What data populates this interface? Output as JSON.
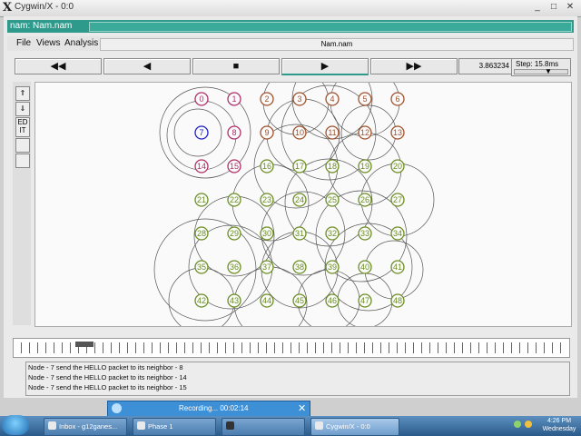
{
  "window": {
    "title": "Cygwin/X - 0:0"
  },
  "nam": {
    "title": "nam: Nam.nam",
    "file_name": "Nam.nam"
  },
  "menu": {
    "file": "File",
    "views": "Views",
    "analysis": "Analysis"
  },
  "controls": {
    "rewind": "◀◀",
    "back": "◀",
    "stop": "■",
    "play": "▶",
    "fast_forward": "▶▶",
    "time": "3.863234",
    "step": "Step: 15.8ms"
  },
  "tools": {
    "zoom_in": "⇑",
    "zoom_out": "⇓",
    "edit": "ED IT",
    "t4": "",
    "t5": ""
  },
  "network": {
    "nodes": [
      {
        "id": "0",
        "color": "#b0306a"
      },
      {
        "id": "1",
        "color": "#b0306a"
      },
      {
        "id": "2",
        "color": "#a0522d"
      },
      {
        "id": "3",
        "color": "#a0522d"
      },
      {
        "id": "4",
        "color": "#a0522d"
      },
      {
        "id": "5",
        "color": "#a0522d"
      },
      {
        "id": "6",
        "color": "#a0522d"
      },
      {
        "id": "7",
        "color": "#2020c8"
      },
      {
        "id": "8",
        "color": "#b0306a"
      },
      {
        "id": "9",
        "color": "#a0522d"
      },
      {
        "id": "10",
        "color": "#a0522d"
      },
      {
        "id": "11",
        "color": "#a0522d"
      },
      {
        "id": "12",
        "color": "#a0522d"
      },
      {
        "id": "13",
        "color": "#a0522d"
      },
      {
        "id": "14",
        "color": "#b0306a"
      },
      {
        "id": "15",
        "color": "#b0306a"
      },
      {
        "id": "16",
        "color": "#6b8e23"
      },
      {
        "id": "17",
        "color": "#6b8e23"
      },
      {
        "id": "18",
        "color": "#6b8e23"
      },
      {
        "id": "19",
        "color": "#6b8e23"
      },
      {
        "id": "20",
        "color": "#6b8e23"
      },
      {
        "id": "21",
        "color": "#6b8e23"
      },
      {
        "id": "22",
        "color": "#6b8e23"
      },
      {
        "id": "23",
        "color": "#6b8e23"
      },
      {
        "id": "24",
        "color": "#6b8e23"
      },
      {
        "id": "25",
        "color": "#6b8e23"
      },
      {
        "id": "26",
        "color": "#6b8e23"
      },
      {
        "id": "27",
        "color": "#6b8e23"
      },
      {
        "id": "28",
        "color": "#6b8e23"
      },
      {
        "id": "29",
        "color": "#6b8e23"
      },
      {
        "id": "30",
        "color": "#6b8e23"
      },
      {
        "id": "31",
        "color": "#6b8e23"
      },
      {
        "id": "32",
        "color": "#6b8e23"
      },
      {
        "id": "33",
        "color": "#6b8e23"
      },
      {
        "id": "34",
        "color": "#6b8e23"
      },
      {
        "id": "35",
        "color": "#6b8e23"
      },
      {
        "id": "36",
        "color": "#6b8e23"
      },
      {
        "id": "37",
        "color": "#6b8e23"
      },
      {
        "id": "38",
        "color": "#6b8e23"
      },
      {
        "id": "39",
        "color": "#6b8e23"
      },
      {
        "id": "40",
        "color": "#6b8e23"
      },
      {
        "id": "41",
        "color": "#6b8e23"
      },
      {
        "id": "42",
        "color": "#6b8e23"
      },
      {
        "id": "43",
        "color": "#6b8e23"
      },
      {
        "id": "44",
        "color": "#6b8e23"
      },
      {
        "id": "45",
        "color": "#6b8e23"
      },
      {
        "id": "46",
        "color": "#6b8e23"
      },
      {
        "id": "47",
        "color": "#6b8e23"
      },
      {
        "id": "48",
        "color": "#6b8e23"
      }
    ]
  },
  "log": [
    "Node - 7 send the HELLO packet to its neighbor - 8",
    "Node - 7 send the HELLO packet to its neighbor - 14",
    "Node - 7 send the HELLO packet to its neighbor - 15"
  ],
  "recording": {
    "text": "Recording... 00:02:14",
    "close": "✕"
  },
  "taskbar": {
    "items": [
      "Inbox - g12ganes...",
      "Phase 1",
      "",
      "Cygwin/X - 0:0"
    ],
    "time": "4:26 PM",
    "day": "Wednesday"
  }
}
